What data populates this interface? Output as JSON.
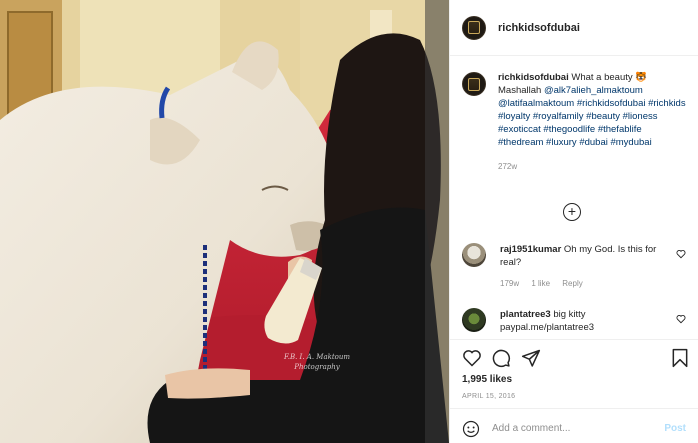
{
  "photo": {
    "watermark_line1": "F.B. I. A. Maktoum",
    "watermark_line2": "Photography"
  },
  "header": {
    "username": "richkidsofdubai"
  },
  "caption": {
    "username": "richkidsofdubai",
    "text": "What a beauty 🐯 Mashallah",
    "mention1": "@alk7alieh_almaktoum",
    "mention2": "@latifaalmaktoum",
    "hashtags": "#richkidsofdubai #richkids #loyalty #royalfamily #beauty #lioness #exoticcat #thegoodlife #thefablife #thedream #luxury #dubai #mydubai",
    "time": "272w"
  },
  "comments": [
    {
      "username": "raj1951kumar",
      "text": "Oh my God. Is this for real?",
      "time": "179w",
      "likes": "1 like",
      "reply": "Reply"
    },
    {
      "username": "plantatree3",
      "text": "big kitty paypal.me/plantatree3"
    }
  ],
  "actions": {
    "likes": "1,995 likes",
    "date": "APRIL 15, 2016",
    "comment_placeholder": "Add a comment...",
    "post_label": "Post"
  },
  "colors": {
    "link": "#00376b",
    "muted": "#8e8e8e",
    "post_disabled": "#b2dffc"
  }
}
